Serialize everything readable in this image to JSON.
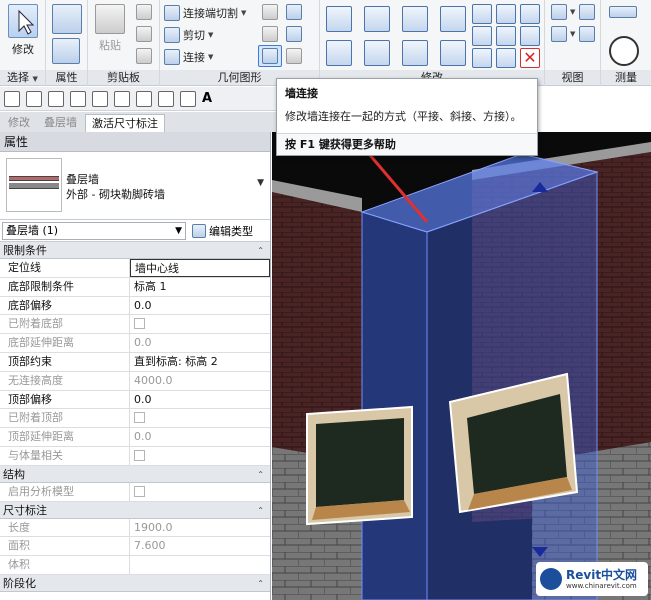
{
  "ribbon": {
    "select": {
      "modify_label": "修改",
      "panel_label": "选择"
    },
    "properties_panel_label": "属性",
    "clipboard": {
      "paste_label": "粘贴",
      "panel_label": "剪贴板"
    },
    "geometry": {
      "cope_label": "连接端切割",
      "cut_label": "剪切",
      "join_label": "连接",
      "panel_label": "几何图形"
    },
    "modify_panel_label": "修改",
    "view_panel_label": "视图",
    "measure_panel_label": "测量"
  },
  "quick_access": {
    "measure_icon": "A"
  },
  "context_tabs": [
    {
      "label": "修改"
    },
    {
      "label": "叠层墙"
    },
    {
      "label": "激活尺寸标注"
    }
  ],
  "properties": {
    "title": "属性",
    "type": {
      "family": "叠层墙",
      "name": "外部 - 砌块勒脚砖墙"
    },
    "instance_selector": "叠层墙 (1)",
    "edit_type_label": "编辑类型",
    "groups": [
      {
        "name": "限制条件",
        "rows": [
          {
            "key": "定位线",
            "value": "墙中心线",
            "disabled": false,
            "editing": true
          },
          {
            "key": "底部限制条件",
            "value": "标高 1",
            "disabled": false
          },
          {
            "key": "底部偏移",
            "value": "0.0",
            "disabled": false
          },
          {
            "key": "已附着底部",
            "value": "",
            "checkbox": true,
            "disabled": true
          },
          {
            "key": "底部延伸距离",
            "value": "0.0",
            "disabled": true
          },
          {
            "key": "顶部约束",
            "value": "直到标高: 标高 2",
            "disabled": false
          },
          {
            "key": "无连接高度",
            "value": "4000.0",
            "disabled": true
          },
          {
            "key": "顶部偏移",
            "value": "0.0",
            "disabled": false
          },
          {
            "key": "已附着顶部",
            "value": "",
            "checkbox": true,
            "disabled": true
          },
          {
            "key": "顶部延伸距离",
            "value": "0.0",
            "disabled": true
          },
          {
            "key": "与体量相关",
            "value": "",
            "checkbox": true,
            "disabled": true
          }
        ]
      },
      {
        "name": "结构",
        "rows": [
          {
            "key": "启用分析模型",
            "value": "",
            "checkbox": true,
            "disabled": true
          }
        ]
      },
      {
        "name": "尺寸标注",
        "rows": [
          {
            "key": "长度",
            "value": "1900.0",
            "disabled": true
          },
          {
            "key": "面积",
            "value": "7.600",
            "disabled": true
          },
          {
            "key": "体积",
            "value": "",
            "disabled": true
          }
        ]
      },
      {
        "name": "阶段化",
        "rows": []
      }
    ]
  },
  "tooltip": {
    "title": "墙连接",
    "description": "修改墙连接在一起的方式（平接、斜接、方接）。",
    "help": "按 F1 键获得更多帮助"
  },
  "watermark": {
    "title": "Revit中文网",
    "url": "www.chinarevit.com"
  },
  "colors": {
    "selection_blue": "#3b5fd6",
    "brick": "#5a2a2a",
    "tooltip_arrow": "#e03030"
  }
}
